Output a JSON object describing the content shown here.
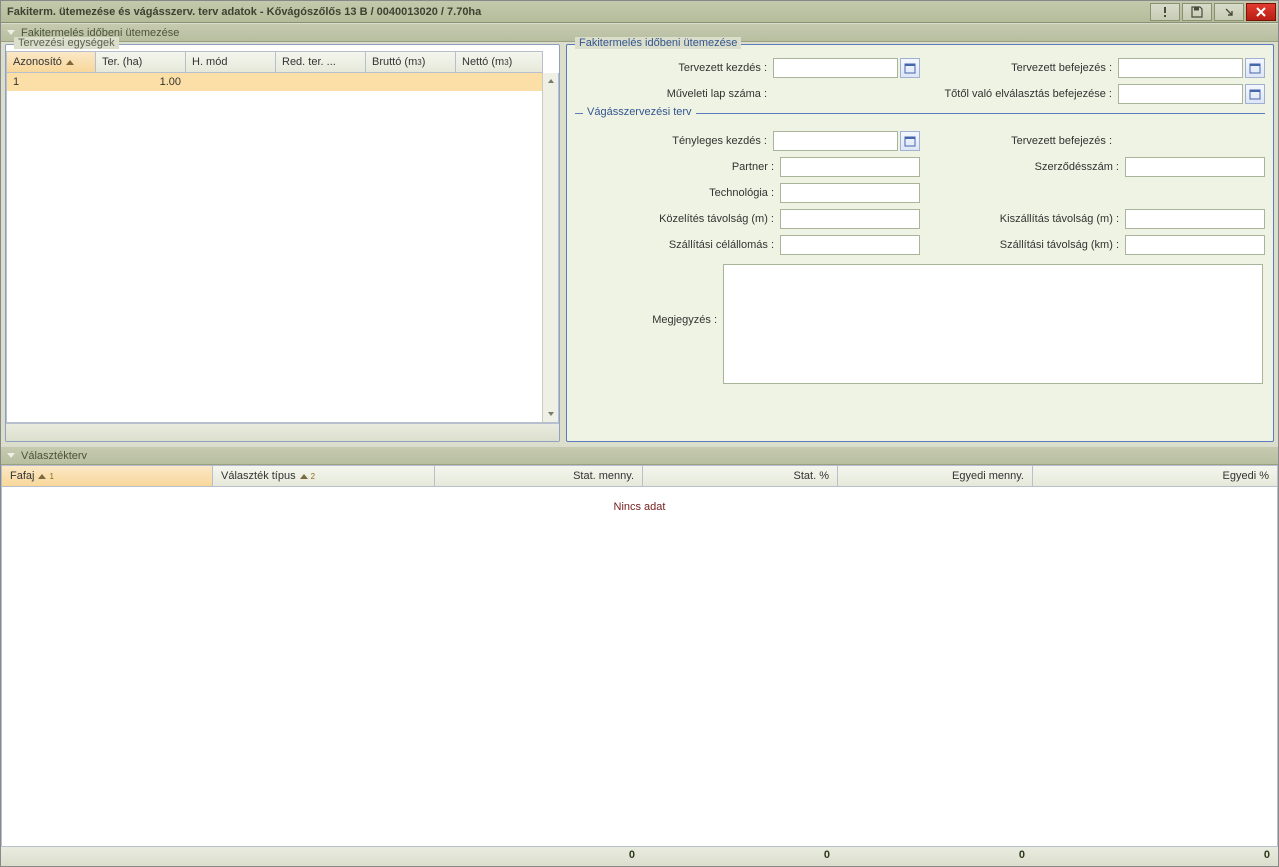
{
  "title": "Fakiterm. ütemezése és vágásszerv. terv adatok - Kővágószőlős 13 B / 0040013020 / 7.70ha",
  "section1": "Fakitermelés időbeni ütemezése",
  "section2": "Választékterv",
  "leftPanel": {
    "legend": "Tervezési egységek",
    "cols": {
      "c0": "Azonosító",
      "c1": "Ter. (ha)",
      "c2": "H. mód",
      "c3": "Red. ter. ...",
      "c4": "Bruttó (m",
      "c4sup": "3",
      "c4post": ")",
      "c5": "Nettó (m",
      "c5sup": "3",
      "c5post": ")"
    },
    "row1": {
      "id": "1",
      "ter": "1.00"
    }
  },
  "formTop": {
    "legend": "Fakitermelés időbeni ütemezése",
    "l_start": "Tervezett kezdés :",
    "l_end": "Tervezett befejezés :",
    "l_sheet": "Műveleti lap száma :",
    "l_cut": "Tőtől való elválasztás befejezése :"
  },
  "formMid": {
    "legend": "Vágásszervezési terv",
    "l_actstart": "Tényleges kezdés :",
    "l_end": "Tervezett befejezés :",
    "l_partner": "Partner :",
    "l_contract": "Szerződésszám :",
    "l_tech": "Technológia :",
    "l_appr": "Közelítés távolság (m) :",
    "l_out": "Kiszállítás távolság (m) :",
    "l_dest": "Szállítási célállomás :",
    "l_dist": "Szállítási távolság (km) :",
    "l_note": "Megjegyzés :"
  },
  "bottom": {
    "cols": {
      "c0": "Fafaj",
      "c1": "Választék típus",
      "c2": "Stat. menny.",
      "c3": "Stat. %",
      "c4": "Egyedi menny.",
      "c5": "Egyedi %"
    },
    "noData": "Nincs adat",
    "footer": {
      "v2": "0",
      "v3": "0",
      "v4": "0",
      "v5": "0"
    }
  }
}
